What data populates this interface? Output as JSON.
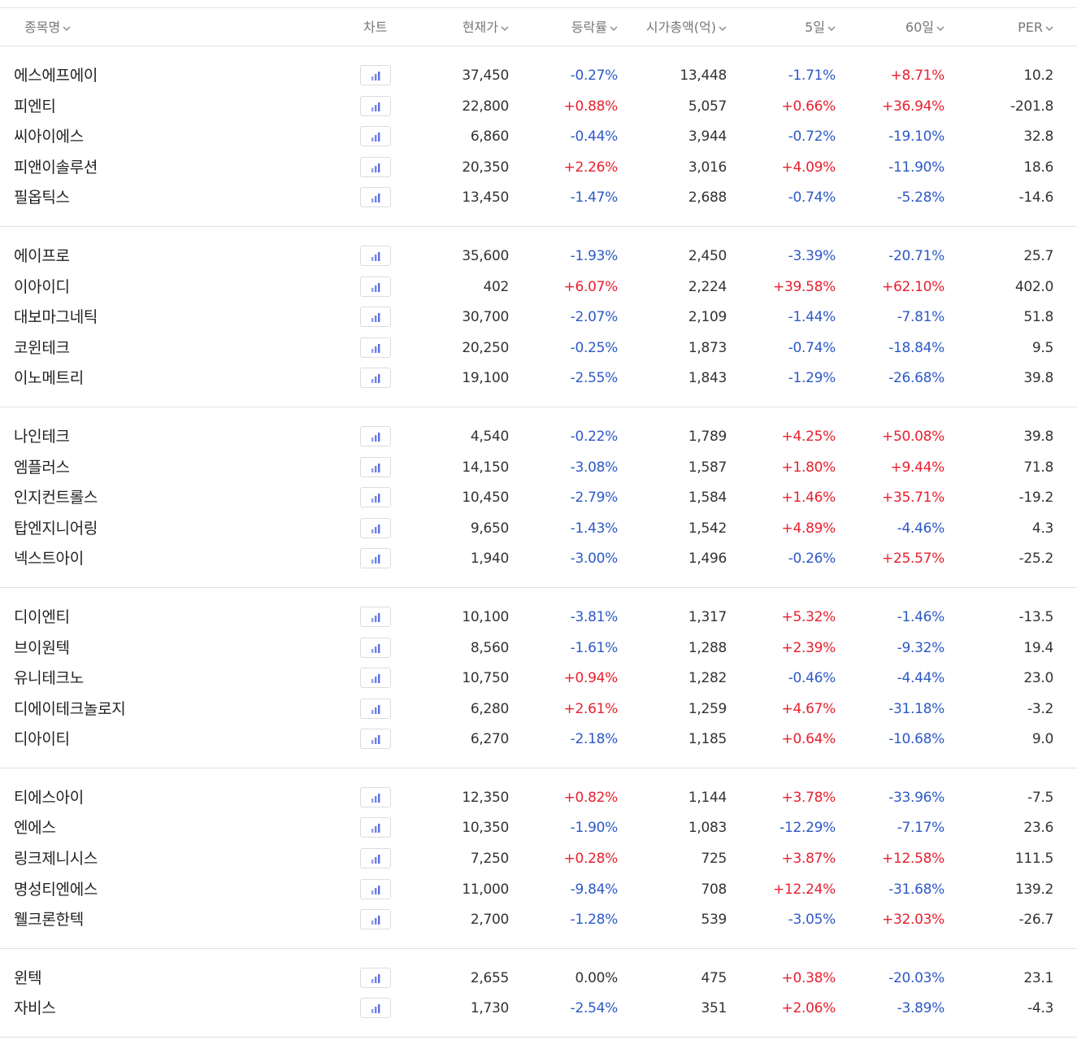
{
  "header": {
    "name": "종목명",
    "chart": "차트",
    "price": "현재가",
    "change": "등락률",
    "market_cap": "시가총액(억)",
    "d5": "5일",
    "d60": "60일",
    "per": "PER"
  },
  "colors": {
    "up": "#e8202f",
    "down": "#2d59c6",
    "flat": "#333333",
    "chart_icon": "#5a6fe0"
  },
  "icons": {
    "sort": "chevron-down-icon",
    "chart": "bar-chart-icon"
  },
  "groups": [
    [
      {
        "name": "에스에프에이",
        "price": "37,450",
        "change": "-0.27%",
        "cap": "13,448",
        "d5": "-1.71%",
        "d60": "+8.71%",
        "per": "10.2"
      },
      {
        "name": "피엔티",
        "price": "22,800",
        "change": "+0.88%",
        "cap": "5,057",
        "d5": "+0.66%",
        "d60": "+36.94%",
        "per": "-201.8"
      },
      {
        "name": "씨아이에스",
        "price": "6,860",
        "change": "-0.44%",
        "cap": "3,944",
        "d5": "-0.72%",
        "d60": "-19.10%",
        "per": "32.8"
      },
      {
        "name": "피앤이솔루션",
        "price": "20,350",
        "change": "+2.26%",
        "cap": "3,016",
        "d5": "+4.09%",
        "d60": "-11.90%",
        "per": "18.6"
      },
      {
        "name": "필옵틱스",
        "price": "13,450",
        "change": "-1.47%",
        "cap": "2,688",
        "d5": "-0.74%",
        "d60": "-5.28%",
        "per": "-14.6"
      }
    ],
    [
      {
        "name": "에이프로",
        "price": "35,600",
        "change": "-1.93%",
        "cap": "2,450",
        "d5": "-3.39%",
        "d60": "-20.71%",
        "per": "25.7"
      },
      {
        "name": "이아이디",
        "price": "402",
        "change": "+6.07%",
        "cap": "2,224",
        "d5": "+39.58%",
        "d60": "+62.10%",
        "per": "402.0"
      },
      {
        "name": "대보마그네틱",
        "price": "30,700",
        "change": "-2.07%",
        "cap": "2,109",
        "d5": "-1.44%",
        "d60": "-7.81%",
        "per": "51.8"
      },
      {
        "name": "코윈테크",
        "price": "20,250",
        "change": "-0.25%",
        "cap": "1,873",
        "d5": "-0.74%",
        "d60": "-18.84%",
        "per": "9.5"
      },
      {
        "name": "이노메트리",
        "price": "19,100",
        "change": "-2.55%",
        "cap": "1,843",
        "d5": "-1.29%",
        "d60": "-26.68%",
        "per": "39.8"
      }
    ],
    [
      {
        "name": "나인테크",
        "price": "4,540",
        "change": "-0.22%",
        "cap": "1,789",
        "d5": "+4.25%",
        "d60": "+50.08%",
        "per": "39.8"
      },
      {
        "name": "엠플러스",
        "price": "14,150",
        "change": "-3.08%",
        "cap": "1,587",
        "d5": "+1.80%",
        "d60": "+9.44%",
        "per": "71.8"
      },
      {
        "name": "인지컨트롤스",
        "price": "10,450",
        "change": "-2.79%",
        "cap": "1,584",
        "d5": "+1.46%",
        "d60": "+35.71%",
        "per": "-19.2"
      },
      {
        "name": "탑엔지니어링",
        "price": "9,650",
        "change": "-1.43%",
        "cap": "1,542",
        "d5": "+4.89%",
        "d60": "-4.46%",
        "per": "4.3"
      },
      {
        "name": "넥스트아이",
        "price": "1,940",
        "change": "-3.00%",
        "cap": "1,496",
        "d5": "-0.26%",
        "d60": "+25.57%",
        "per": "-25.2"
      }
    ],
    [
      {
        "name": "디이엔티",
        "price": "10,100",
        "change": "-3.81%",
        "cap": "1,317",
        "d5": "+5.32%",
        "d60": "-1.46%",
        "per": "-13.5"
      },
      {
        "name": "브이원텍",
        "price": "8,560",
        "change": "-1.61%",
        "cap": "1,288",
        "d5": "+2.39%",
        "d60": "-9.32%",
        "per": "19.4"
      },
      {
        "name": "유니테크노",
        "price": "10,750",
        "change": "+0.94%",
        "cap": "1,282",
        "d5": "-0.46%",
        "d60": "-4.44%",
        "per": "23.0"
      },
      {
        "name": "디에이테크놀로지",
        "price": "6,280",
        "change": "+2.61%",
        "cap": "1,259",
        "d5": "+4.67%",
        "d60": "-31.18%",
        "per": "-3.2"
      },
      {
        "name": "디아이티",
        "price": "6,270",
        "change": "-2.18%",
        "cap": "1,185",
        "d5": "+0.64%",
        "d60": "-10.68%",
        "per": "9.0"
      }
    ],
    [
      {
        "name": "티에스아이",
        "price": "12,350",
        "change": "+0.82%",
        "cap": "1,144",
        "d5": "+3.78%",
        "d60": "-33.96%",
        "per": "-7.5"
      },
      {
        "name": "엔에스",
        "price": "10,350",
        "change": "-1.90%",
        "cap": "1,083",
        "d5": "-12.29%",
        "d60": "-7.17%",
        "per": "23.6"
      },
      {
        "name": "링크제니시스",
        "price": "7,250",
        "change": "+0.28%",
        "cap": "725",
        "d5": "+3.87%",
        "d60": "+12.58%",
        "per": "111.5"
      },
      {
        "name": "명성티엔에스",
        "price": "11,000",
        "change": "-9.84%",
        "cap": "708",
        "d5": "+12.24%",
        "d60": "-31.68%",
        "per": "139.2"
      },
      {
        "name": "웰크론한텍",
        "price": "2,700",
        "change": "-1.28%",
        "cap": "539",
        "d5": "-3.05%",
        "d60": "+32.03%",
        "per": "-26.7"
      }
    ],
    [
      {
        "name": "윈텍",
        "price": "2,655",
        "change": "0.00%",
        "cap": "475",
        "d5": "+0.38%",
        "d60": "-20.03%",
        "per": "23.1"
      },
      {
        "name": "자비스",
        "price": "1,730",
        "change": "-2.54%",
        "cap": "351",
        "d5": "+2.06%",
        "d60": "-3.89%",
        "per": "-4.3"
      }
    ]
  ]
}
